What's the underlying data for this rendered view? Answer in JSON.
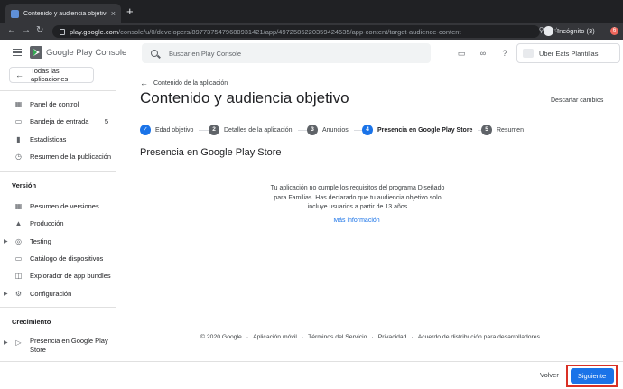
{
  "browser": {
    "tab_title": "Contenido y audiencia objetivo",
    "tab_close": "×",
    "new_tab": "+",
    "url_host": "play.google.com",
    "url_path": "/console/u/0/developers/8977375479680931421/app/4972585220359424535/app-content/target-audience-content",
    "incognito_label": "Incógnito (3)",
    "badge": "6"
  },
  "header": {
    "brand_google": "Google Play",
    "brand_console": " Console",
    "search_placeholder": "Buscar en Play Console",
    "account_name": "Uber Eats Plantillas"
  },
  "sidebar": {
    "all_apps": "Todas las aplicaciones",
    "items_top": [
      {
        "label": "Panel de control",
        "icon": "dashboard-icon"
      },
      {
        "label": "Bandeja de entrada",
        "count": "5",
        "icon": "inbox-icon"
      },
      {
        "label": "Estadísticas",
        "icon": "stats-icon"
      },
      {
        "label": "Resumen de la publicación",
        "icon": "publish-icon"
      }
    ],
    "section_version": "Versión",
    "items_version": [
      {
        "label": "Resumen de versiones"
      },
      {
        "label": "Producción"
      },
      {
        "label": "Testing"
      },
      {
        "label": "Catálogo de dispositivos"
      },
      {
        "label": "Explorador de app bundles"
      },
      {
        "label": "Configuración"
      }
    ],
    "section_growth": "Crecimiento",
    "items_growth": [
      {
        "label": "Presencia en Google Play Store"
      }
    ]
  },
  "main": {
    "breadcrumb": "Contenido de la aplicación",
    "title": "Contenido y audiencia objetivo",
    "discard": "Descartar cambios",
    "steps": [
      {
        "number": "✓",
        "label": "Edad objetivo"
      },
      {
        "number": "2",
        "label": "Detalles de la aplicación"
      },
      {
        "number": "3",
        "label": "Anuncios"
      },
      {
        "number": "4",
        "label": "Presencia en Google Play Store"
      },
      {
        "number": "5",
        "label": "Resumen"
      }
    ],
    "section_title": "Presencia en Google Play Store",
    "message": "Tu aplicación no cumple los requisitos del programa Diseñado para Familias. Has declarado que tu audiencia objetivo solo incluye usuarios a partir de 13 años",
    "more_info": "Más información"
  },
  "footer": {
    "copyright": "© 2020 Google",
    "links": [
      "Aplicación móvil",
      "Términos del Servicio",
      "Privacidad",
      "Acuerdo de distribución para desarrolladores"
    ]
  },
  "actions": {
    "back": "Volver",
    "next": "Siguiente"
  },
  "colors": {
    "accent": "#1a73e8",
    "highlight": "#d93025"
  }
}
